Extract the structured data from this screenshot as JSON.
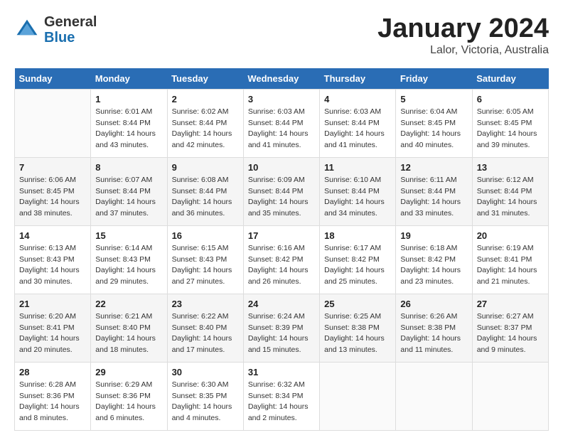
{
  "header": {
    "logo_general": "General",
    "logo_blue": "Blue",
    "month": "January 2024",
    "location": "Lalor, Victoria, Australia"
  },
  "days_of_week": [
    "Sunday",
    "Monday",
    "Tuesday",
    "Wednesday",
    "Thursday",
    "Friday",
    "Saturday"
  ],
  "weeks": [
    [
      {
        "day": "",
        "info": ""
      },
      {
        "day": "1",
        "info": "Sunrise: 6:01 AM\nSunset: 8:44 PM\nDaylight: 14 hours\nand 43 minutes."
      },
      {
        "day": "2",
        "info": "Sunrise: 6:02 AM\nSunset: 8:44 PM\nDaylight: 14 hours\nand 42 minutes."
      },
      {
        "day": "3",
        "info": "Sunrise: 6:03 AM\nSunset: 8:44 PM\nDaylight: 14 hours\nand 41 minutes."
      },
      {
        "day": "4",
        "info": "Sunrise: 6:03 AM\nSunset: 8:44 PM\nDaylight: 14 hours\nand 41 minutes."
      },
      {
        "day": "5",
        "info": "Sunrise: 6:04 AM\nSunset: 8:45 PM\nDaylight: 14 hours\nand 40 minutes."
      },
      {
        "day": "6",
        "info": "Sunrise: 6:05 AM\nSunset: 8:45 PM\nDaylight: 14 hours\nand 39 minutes."
      }
    ],
    [
      {
        "day": "7",
        "info": "Sunrise: 6:06 AM\nSunset: 8:45 PM\nDaylight: 14 hours\nand 38 minutes."
      },
      {
        "day": "8",
        "info": "Sunrise: 6:07 AM\nSunset: 8:44 PM\nDaylight: 14 hours\nand 37 minutes."
      },
      {
        "day": "9",
        "info": "Sunrise: 6:08 AM\nSunset: 8:44 PM\nDaylight: 14 hours\nand 36 minutes."
      },
      {
        "day": "10",
        "info": "Sunrise: 6:09 AM\nSunset: 8:44 PM\nDaylight: 14 hours\nand 35 minutes."
      },
      {
        "day": "11",
        "info": "Sunrise: 6:10 AM\nSunset: 8:44 PM\nDaylight: 14 hours\nand 34 minutes."
      },
      {
        "day": "12",
        "info": "Sunrise: 6:11 AM\nSunset: 8:44 PM\nDaylight: 14 hours\nand 33 minutes."
      },
      {
        "day": "13",
        "info": "Sunrise: 6:12 AM\nSunset: 8:44 PM\nDaylight: 14 hours\nand 31 minutes."
      }
    ],
    [
      {
        "day": "14",
        "info": "Sunrise: 6:13 AM\nSunset: 8:43 PM\nDaylight: 14 hours\nand 30 minutes."
      },
      {
        "day": "15",
        "info": "Sunrise: 6:14 AM\nSunset: 8:43 PM\nDaylight: 14 hours\nand 29 minutes."
      },
      {
        "day": "16",
        "info": "Sunrise: 6:15 AM\nSunset: 8:43 PM\nDaylight: 14 hours\nand 27 minutes."
      },
      {
        "day": "17",
        "info": "Sunrise: 6:16 AM\nSunset: 8:42 PM\nDaylight: 14 hours\nand 26 minutes."
      },
      {
        "day": "18",
        "info": "Sunrise: 6:17 AM\nSunset: 8:42 PM\nDaylight: 14 hours\nand 25 minutes."
      },
      {
        "day": "19",
        "info": "Sunrise: 6:18 AM\nSunset: 8:42 PM\nDaylight: 14 hours\nand 23 minutes."
      },
      {
        "day": "20",
        "info": "Sunrise: 6:19 AM\nSunset: 8:41 PM\nDaylight: 14 hours\nand 21 minutes."
      }
    ],
    [
      {
        "day": "21",
        "info": "Sunrise: 6:20 AM\nSunset: 8:41 PM\nDaylight: 14 hours\nand 20 minutes."
      },
      {
        "day": "22",
        "info": "Sunrise: 6:21 AM\nSunset: 8:40 PM\nDaylight: 14 hours\nand 18 minutes."
      },
      {
        "day": "23",
        "info": "Sunrise: 6:22 AM\nSunset: 8:40 PM\nDaylight: 14 hours\nand 17 minutes."
      },
      {
        "day": "24",
        "info": "Sunrise: 6:24 AM\nSunset: 8:39 PM\nDaylight: 14 hours\nand 15 minutes."
      },
      {
        "day": "25",
        "info": "Sunrise: 6:25 AM\nSunset: 8:38 PM\nDaylight: 14 hours\nand 13 minutes."
      },
      {
        "day": "26",
        "info": "Sunrise: 6:26 AM\nSunset: 8:38 PM\nDaylight: 14 hours\nand 11 minutes."
      },
      {
        "day": "27",
        "info": "Sunrise: 6:27 AM\nSunset: 8:37 PM\nDaylight: 14 hours\nand 9 minutes."
      }
    ],
    [
      {
        "day": "28",
        "info": "Sunrise: 6:28 AM\nSunset: 8:36 PM\nDaylight: 14 hours\nand 8 minutes."
      },
      {
        "day": "29",
        "info": "Sunrise: 6:29 AM\nSunset: 8:36 PM\nDaylight: 14 hours\nand 6 minutes."
      },
      {
        "day": "30",
        "info": "Sunrise: 6:30 AM\nSunset: 8:35 PM\nDaylight: 14 hours\nand 4 minutes."
      },
      {
        "day": "31",
        "info": "Sunrise: 6:32 AM\nSunset: 8:34 PM\nDaylight: 14 hours\nand 2 minutes."
      },
      {
        "day": "",
        "info": ""
      },
      {
        "day": "",
        "info": ""
      },
      {
        "day": "",
        "info": ""
      }
    ]
  ]
}
